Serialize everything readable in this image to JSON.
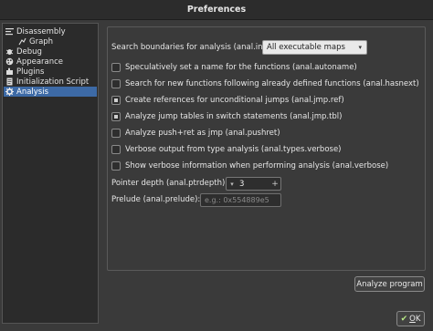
{
  "window": {
    "title": "Preferences"
  },
  "sidebar": {
    "items": [
      {
        "label": "Disassembly",
        "icon": "list-icon"
      },
      {
        "label": "Graph",
        "icon": "graph-icon"
      },
      {
        "label": "Debug",
        "icon": "bug-icon"
      },
      {
        "label": "Appearance",
        "icon": "palette-icon"
      },
      {
        "label": "Plugins",
        "icon": "plugin-icon"
      },
      {
        "label": "Initialization Script",
        "icon": "script-icon"
      },
      {
        "label": "Analysis",
        "icon": "gear-icon",
        "selected": true
      }
    ]
  },
  "analysis": {
    "search_boundaries_label": "Search boundaries for analysis (anal.in):",
    "search_boundaries_value": "All executable maps",
    "options": [
      {
        "label": "Speculatively set a name for the functions (anal.autoname)",
        "checked": false
      },
      {
        "label": "Search for new functions following already defined functions (anal.hasnext)",
        "checked": false
      },
      {
        "label": "Create references for unconditional jumps (anal.jmp.ref)",
        "checked": true
      },
      {
        "label": "Analyze jump tables in switch statements (anal.jmp.tbl)",
        "checked": true
      },
      {
        "label": "Analyze push+ret as jmp (anal.pushret)",
        "checked": false
      },
      {
        "label": "Verbose output from type analysis (anal.types.verbose)",
        "checked": false
      },
      {
        "label": "Show verbose information when performing analysis (anal.verbose)",
        "checked": false
      }
    ],
    "pointer_depth_label": "Pointer depth (anal.ptrdepth):",
    "pointer_depth_value": "3",
    "prelude_label": "Prelude (anal.prelude):",
    "prelude_placeholder": "e.g.: 0x554889e5",
    "analyze_button": "Analyze program"
  },
  "dialog": {
    "ok_label_prefix": "",
    "ok_underline": "O",
    "ok_rest": "K"
  }
}
